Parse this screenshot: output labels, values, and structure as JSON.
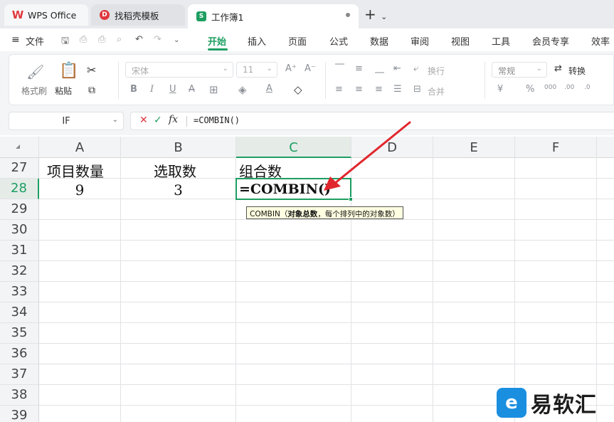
{
  "tabs": [
    {
      "label": "WPS Office",
      "icon": "wps-logo-icon"
    },
    {
      "label": "找稻壳模板",
      "icon": "docer-icon"
    },
    {
      "label": "工作簿1",
      "icon": "spreadsheet-icon"
    }
  ],
  "menu": {
    "file": "文件",
    "items": [
      "开始",
      "插入",
      "页面",
      "公式",
      "数据",
      "审阅",
      "视图",
      "工具",
      "会员专享",
      "效率"
    ]
  },
  "ribbon": {
    "format_painter": "格式刷",
    "paste": "粘贴",
    "font_name": "宋体",
    "font_size": "11",
    "wrap": "换行",
    "merge": "合并",
    "number_format": "常规",
    "convert": "转换"
  },
  "formula_bar": {
    "name_box": "IF",
    "fx": "fx",
    "formula": "=COMBIN()"
  },
  "columns": [
    "A",
    "B",
    "C",
    "D",
    "E",
    "F"
  ],
  "rows": [
    "27",
    "28",
    "29",
    "30",
    "31",
    "32",
    "33",
    "34",
    "35",
    "36",
    "37",
    "38",
    "39"
  ],
  "cells": {
    "A27": "项目数量",
    "B27": "选取数",
    "C27": "组合数",
    "A28": "9",
    "B28": "3",
    "C28": "=COMBIN()"
  },
  "tooltip": {
    "func": "COMBIN",
    "open": "（",
    "arg1": "对象总数",
    "rest": "，每个排列中的对象数）"
  },
  "watermark": "易软汇",
  "colors": {
    "accent": "#1e9e61",
    "arrow": "#e0262c"
  }
}
